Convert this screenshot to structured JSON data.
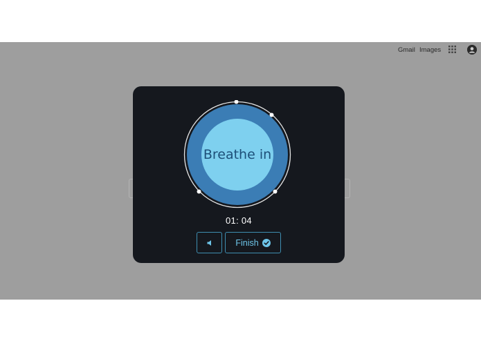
{
  "topbar": {
    "gmail_label": "Gmail",
    "images_label": "Images"
  },
  "breathing": {
    "prompt": "Breathe in",
    "timer": "01: 04"
  },
  "controls": {
    "finish_label": "Finish"
  },
  "colors": {
    "page_overlay": "#9e9e9e",
    "dialog_bg": "#15181e",
    "outer_circle": "#3b7db5",
    "inner_circle": "#7ed0ef",
    "accent": "#6ec6ea",
    "button_border": "#3f8fb2"
  },
  "icons": {
    "apps": "apps-grid-icon",
    "avatar": "user-avatar-icon",
    "sound": "speaker-icon",
    "finish": "check-circle-icon"
  }
}
